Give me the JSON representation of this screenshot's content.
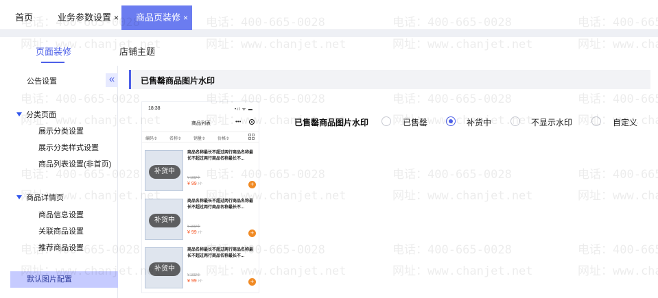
{
  "tabs": {
    "home": "首页",
    "business": "业务参数设置",
    "active": "商品页装修",
    "close": "×"
  },
  "subtabs": {
    "decor": "页面装修",
    "theme": "店铺主题"
  },
  "sidebar": {
    "announcement": "公告设置",
    "collapse_icon": "«",
    "category_group": "分类页面",
    "category_items": [
      "展示分类设置",
      "展示分类样式设置",
      "商品列表设置(非首页)"
    ],
    "detail_group": "商品详情页",
    "detail_items": [
      "商品信息设置",
      "关联商品设置",
      "推荐商品设置"
    ],
    "active_item": "默认图片配置"
  },
  "section": {
    "title": "已售罄商品图片水印"
  },
  "phone": {
    "time": "18:38",
    "signal": "•ıl ᯤ ▬",
    "title": "商品列表",
    "more": "•••",
    "filters": [
      "编码⇕",
      "名称⇕",
      "销量⇕",
      "价格⇕"
    ],
    "products": [
      {
        "name": "商品名称最长不超过两行商品名称最长不超过两行商品名称最长不...",
        "badge": "补货中",
        "old_price": "¥ 100/个",
        "price": "¥ 99",
        "unit": "/个",
        "add": "+"
      },
      {
        "name": "商品名称最长不超过两行商品名称最长不超过两行商品名称最长不...",
        "badge": "补货中",
        "old_price": "¥ 100/个",
        "price": "¥ 99",
        "unit": "/个",
        "add": "+"
      },
      {
        "name": "商品名称最长不超过两行商品名称最长不超过两行商品名称最长不...",
        "badge": "补货中",
        "old_price": "¥ 100/个",
        "price": "¥ 99",
        "unit": "/个",
        "add": "+"
      }
    ]
  },
  "watermark_option": {
    "label": "已售罄商品图片水印",
    "options": [
      "已售罄",
      "补货中",
      "不显示水印",
      "自定义"
    ],
    "selected_index": 1
  },
  "watermark": {
    "phone": "电话：400-665-0028",
    "site": "网址：www.chanjet.net"
  },
  "colors": {
    "accent": "#4d60e8",
    "active_tab": "#6b7cf0",
    "price": "#f4511e",
    "add_button": "#f08a24"
  }
}
